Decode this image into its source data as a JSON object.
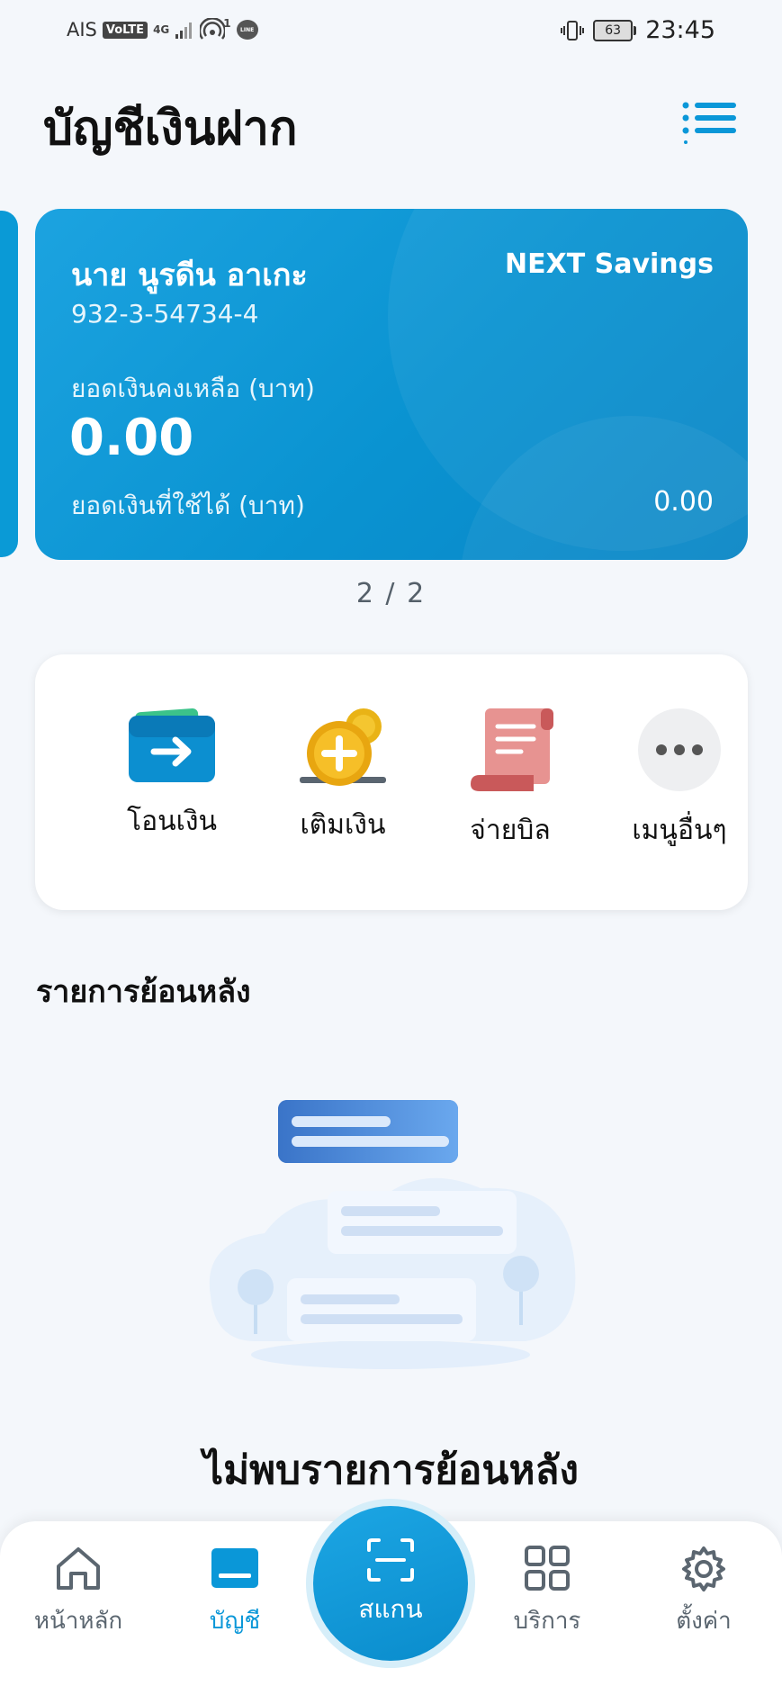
{
  "status_bar": {
    "carrier": "AIS",
    "volte": "VoLTE",
    "network": "4G",
    "hotspot_count": "1",
    "line_badge": "LINE",
    "battery": "63",
    "time": "23:45"
  },
  "header": {
    "title": "บัญชีเงินฝาก",
    "menu_icon": "list-menu-icon"
  },
  "account_card": {
    "holder_name": "นาย นูรดีน อาเกะ",
    "product": "NEXT Savings",
    "account_number": "932-3-54734-4",
    "balance_label": "ยอดเงินคงเหลือ (บาท)",
    "balance": "0.00",
    "available_label": "ยอดเงินที่ใช้ได้ (บาท)",
    "available": "0.00",
    "gradient_colors": [
      "#1ca3e0",
      "#0a86c6"
    ]
  },
  "carousel": {
    "indicator": "2 / 2"
  },
  "quick_actions": [
    {
      "label": "โอนเงิน",
      "icon": "transfer-wallet-icon"
    },
    {
      "label": "เติมเงิน",
      "icon": "topup-coin-icon"
    },
    {
      "label": "จ่ายบิล",
      "icon": "bill-scroll-icon"
    },
    {
      "label": "เมนูอื่นๆ",
      "icon": "more-dots-icon"
    }
  ],
  "history": {
    "title": "รายการย้อนหลัง",
    "empty_message": "ไม่พบรายการย้อนหลัง"
  },
  "bottom_nav": {
    "items": [
      {
        "label": "หน้าหลัก",
        "icon": "home-icon",
        "active": false
      },
      {
        "label": "บัญชี",
        "icon": "account-card-icon",
        "active": true
      },
      {
        "label": "บริการ",
        "icon": "services-grid-icon",
        "active": false
      },
      {
        "label": "ตั้งค่า",
        "icon": "settings-gear-icon",
        "active": false
      }
    ],
    "scan": {
      "label": "สแกน",
      "icon": "scan-icon"
    }
  },
  "colors": {
    "accent": "#0a97d8",
    "background": "#f4f7fb",
    "nav_inactive": "#5b6670"
  }
}
